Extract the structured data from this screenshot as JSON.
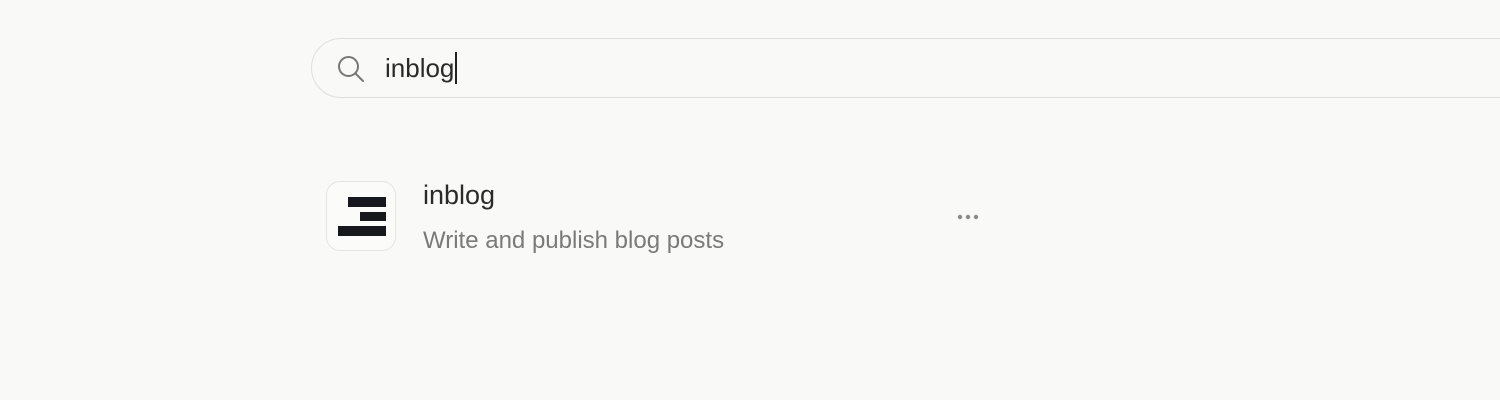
{
  "search": {
    "value": "inblog",
    "icon": "search-icon"
  },
  "results": [
    {
      "name": "inblog",
      "description": "Write and publish blog posts",
      "icon": "inblog-logo-icon",
      "menu_icon": "more-horizontal-icon"
    }
  ],
  "colors": {
    "background": "#f9f9f7",
    "border": "#dfdfdc",
    "text_primary": "#2a2a2a",
    "text_secondary": "#7a7a7a",
    "logo": "#16181d"
  }
}
